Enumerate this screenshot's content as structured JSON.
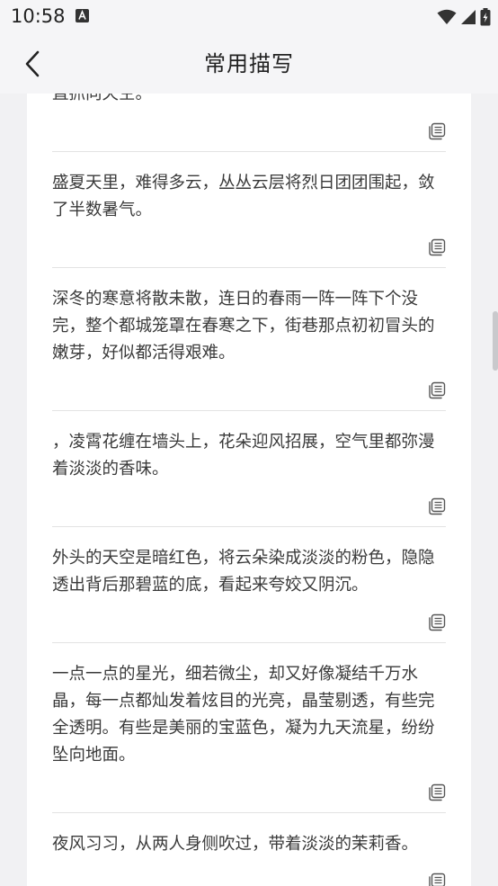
{
  "status_bar": {
    "time": "10:58"
  },
  "header": {
    "title": "常用描写"
  },
  "items": [
    {
      "text": "直抓向天空。"
    },
    {
      "text": "盛夏天里，难得多云，丛丛云层将烈日团团围起，敛了半数暑气。"
    },
    {
      "text": "深冬的寒意将散未散，连日的春雨一阵一阵下个没完，整个都城笼罩在春寒之下，街巷那点初初冒头的嫩芽，好似都活得艰难。"
    },
    {
      "text": "，凌霄花缠在墙头上，花朵迎风招展，空气里都弥漫着淡淡的香味。"
    },
    {
      "text": "外头的天空是暗红色，将云朵染成淡淡的粉色，隐隐透出背后那碧蓝的底，看起来夸姣又阴沉。"
    },
    {
      "text": "一点一点的星光，细若微尘，却又好像凝结千万水晶，每一点都灿发着炫目的光亮，晶莹剔透，有些完全透明。有些是美丽的宝蓝色，凝为九天流星，纷纷坠向地面。"
    },
    {
      "text": "夜风习习，从两人身侧吹过，带着淡淡的茉莉香。"
    }
  ]
}
